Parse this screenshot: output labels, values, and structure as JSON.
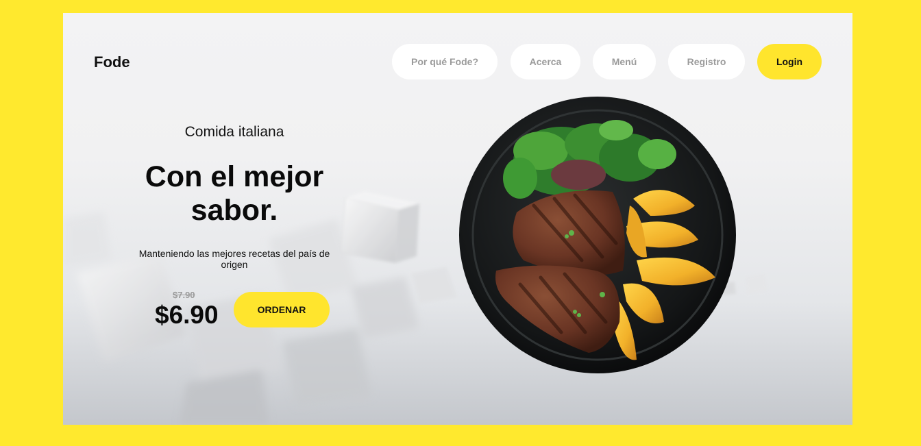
{
  "colors": {
    "page_background": "#ffe92e",
    "accent": "#ffe52d",
    "nav_text": "#9a9a9a",
    "text_dark": "#111111"
  },
  "brand": {
    "name": "Fode"
  },
  "nav": {
    "items": [
      {
        "label": "Por qué Fode?"
      },
      {
        "label": "Acerca"
      },
      {
        "label": "Menú"
      },
      {
        "label": "Registro"
      }
    ],
    "login_label": "Login"
  },
  "hero": {
    "subtitle": "Comida italiana",
    "title": "Con el mejor sabor.",
    "description": "Manteniendo las mejores recetas del país de origen",
    "old_price": "$7.90",
    "price": "$6.90",
    "order_label": "ORDENAR"
  },
  "icons": {
    "dish_image": "steak-plate-image"
  }
}
